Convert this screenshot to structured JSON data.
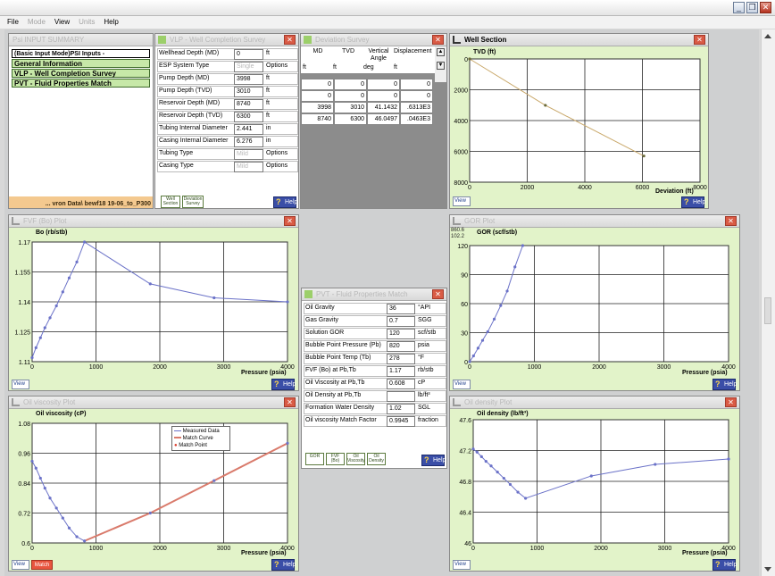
{
  "menu": [
    {
      "label": "File",
      "enabled": true
    },
    {
      "label": "Mode",
      "enabled": false
    },
    {
      "label": "View",
      "enabled": true
    },
    {
      "label": "Units",
      "enabled": false
    },
    {
      "label": "Help",
      "enabled": true
    }
  ],
  "window_buttons": {
    "minimize": "_",
    "restore": "❒",
    "close": "✕"
  },
  "psi_input": {
    "title": "Psi INPUT SUMMARY",
    "items": [
      "(Basic Input Mode)PSI Inputs -",
      "General Information",
      "VLP - Well Completion Survey",
      "PVT - Fluid Properties Match"
    ],
    "path": "... vron Data\\ bewf18 19-06_to_P300"
  },
  "vlp": {
    "title": "VLP - Well Completion Survey",
    "rows": [
      {
        "label": "Wellhead Depth (MD)",
        "value": "0",
        "unit": "ft",
        "dim": false
      },
      {
        "label": "ESP System Type",
        "value": "Single",
        "unit": "Options",
        "dim": true
      },
      {
        "label": "Pump Depth (MD)",
        "value": "3998",
        "unit": "ft",
        "dim": false
      },
      {
        "label": "Pump Depth (TVD)",
        "value": "3010",
        "unit": "ft",
        "dim": false
      },
      {
        "label": "Reservoir Depth (MD)",
        "value": "8740",
        "unit": "ft",
        "dim": false
      },
      {
        "label": "Reservoir Depth (TVD)",
        "value": "6300",
        "unit": "ft",
        "dim": false
      },
      {
        "label": "Tubing Internal Diameter",
        "value": "2.441",
        "unit": "in",
        "dim": false
      },
      {
        "label": "Casing Internal Diameter",
        "value": "6.276",
        "unit": "in",
        "dim": false
      },
      {
        "label": "Tubing Type",
        "value": "Mild",
        "unit": "Options",
        "dim": true
      },
      {
        "label": "Casing Type",
        "value": "Mild",
        "unit": "Options",
        "dim": true
      }
    ],
    "buttons": [
      "Well Section",
      "Deviation Survey"
    ],
    "help": "Help"
  },
  "deviation": {
    "title": "Deviation Survey",
    "headers": [
      "MD",
      "TVD",
      "Vertical Angle",
      "Displacement"
    ],
    "header_units": [
      "ft",
      "ft",
      "deg",
      "ft"
    ],
    "rows": [
      [
        "0",
        "0",
        "0",
        "0"
      ],
      [
        "0",
        "0",
        "0",
        "0"
      ],
      [
        "3998",
        "3010",
        "41.1432",
        ".6313E3"
      ],
      [
        "8740",
        "6300",
        "46.0497",
        ".0463E3"
      ]
    ]
  },
  "well_section": {
    "title": "Well Section",
    "ylabel": "TVD (ft)",
    "xlabel": "Deviation (ft)",
    "view": "View",
    "help": "Help",
    "chart_data": {
      "type": "line",
      "x": [
        0,
        2630,
        6050
      ],
      "y": [
        0,
        3010,
        6300
      ],
      "xlim": [
        0,
        8000
      ],
      "ylim": [
        0,
        8000
      ],
      "xticks": [
        "0",
        "2000",
        "4000",
        "6000",
        "8000"
      ],
      "yticks": [
        "0",
        "2000",
        "4000",
        "6000",
        "8000"
      ],
      "y_inverted": true,
      "line_color": "#c9a86a"
    }
  },
  "fvf": {
    "title": "FVF (Bo) Plot",
    "ylabel": "Bo (rb/stb)",
    "xlabel": "Pressure (psia)",
    "view": "View",
    "help": "Help",
    "chart_data": {
      "type": "line",
      "x": [
        0,
        60,
        130,
        200,
        280,
        380,
        480,
        580,
        700,
        820,
        1850,
        2850,
        4000
      ],
      "y": [
        1.112,
        1.117,
        1.122,
        1.127,
        1.132,
        1.138,
        1.145,
        1.152,
        1.16,
        1.17,
        1.149,
        1.142,
        1.14
      ],
      "xlim": [
        0,
        4000
      ],
      "ylim": [
        1.11,
        1.17
      ],
      "xticks": [
        "0",
        "1000",
        "2000",
        "3000",
        "4000"
      ],
      "yticks": [
        "1.11",
        "1.125",
        "1.14",
        "1.155",
        "1.17"
      ],
      "line_color": "#6b72c8"
    }
  },
  "gor": {
    "title": "GOR Plot",
    "ylabel": "GOR (scf/stb)",
    "xlabel": "Pressure (psia)",
    "corner_labels": [
      "860.6",
      "102.2"
    ],
    "view": "View",
    "help": "Help",
    "chart_data": {
      "type": "line",
      "x": [
        0,
        60,
        130,
        200,
        280,
        380,
        480,
        580,
        700,
        820
      ],
      "y": [
        0,
        6,
        14,
        22,
        31,
        44,
        58,
        73,
        98,
        120
      ],
      "xlim": [
        0,
        4000
      ],
      "ylim": [
        0,
        120
      ],
      "xticks": [
        "0",
        "1000",
        "2000",
        "3000",
        "4000"
      ],
      "yticks": [
        "0",
        "30",
        "60",
        "90",
        "120"
      ],
      "line_color": "#6b72c8"
    }
  },
  "visc": {
    "title": "Oil viscosity Plot",
    "ylabel": "Oil viscosity (cP)",
    "xlabel": "Pressure (psia)",
    "legend": [
      "Measured Data",
      "Match Curve",
      "Match Point"
    ],
    "match_button": "Match",
    "view": "View",
    "help": "Help",
    "chart_data": {
      "type": "line",
      "x": [
        0,
        60,
        130,
        200,
        280,
        380,
        480,
        580,
        700,
        820,
        1850,
        2850,
        4000
      ],
      "y": [
        0.928,
        0.9,
        0.86,
        0.82,
        0.78,
        0.74,
        0.7,
        0.66,
        0.625,
        0.608,
        0.72,
        0.85,
        1.0
      ],
      "match_x": [
        820,
        1850,
        2850,
        4000
      ],
      "match_y": [
        0.608,
        0.72,
        0.85,
        1.0
      ],
      "xlim": [
        0,
        4000
      ],
      "ylim": [
        0.6,
        1.08
      ],
      "xticks": [
        "0",
        "1000",
        "2000",
        "3000",
        "4000"
      ],
      "yticks": [
        "0.6",
        "0.72",
        "0.84",
        "0.96",
        "1.08"
      ],
      "line_color": "#6b72c8",
      "match_color": "#d97a6b"
    }
  },
  "pvt": {
    "title": "PVT - Fluid Properties Match",
    "rows": [
      {
        "label": "Oil Gravity",
        "value": "36",
        "unit": "°API"
      },
      {
        "label": "Gas Gravity",
        "value": "0.7",
        "unit": "SGG"
      },
      {
        "label": "Solution GOR",
        "value": "120",
        "unit": "scf/stb"
      },
      {
        "label": "Bubble Point Pressure (Pb)",
        "value": "820",
        "unit": "psia"
      },
      {
        "label": "Bubble Point Temp (Tb)",
        "value": "278",
        "unit": "°F"
      },
      {
        "label": "FVF (Bo) at Pb,Tb",
        "value": "1.17",
        "unit": "rb/stb"
      },
      {
        "label": "Oil Viscosity at Pb,Tb",
        "value": "0.608",
        "unit": "cP"
      },
      {
        "label": "Oil Density at Pb,Tb",
        "value": "",
        "unit": "lb/ft³"
      },
      {
        "label": "Formation Water Density",
        "value": "1.02",
        "unit": "SGL"
      },
      {
        "label": "Oil viscosity Match Factor",
        "value": "0.9945",
        "unit": "fraction"
      }
    ],
    "buttons": [
      "GOR",
      "FVF (Bo)",
      "Oil Viscosity",
      "Oil Density"
    ],
    "help": "Help"
  },
  "density": {
    "title": "Oil density Plot",
    "ylabel": "Oil density (lb/ft³)",
    "xlabel": "Pressure (psia)",
    "view": "View",
    "help": "Help",
    "chart_data": {
      "type": "line",
      "x": [
        0,
        60,
        130,
        200,
        280,
        380,
        480,
        580,
        700,
        820,
        1850,
        2850,
        4000
      ],
      "y": [
        47.22,
        47.18,
        47.12,
        47.06,
        47.0,
        46.92,
        46.84,
        46.76,
        46.66,
        46.58,
        46.87,
        47.02,
        47.09
      ],
      "xlim": [
        0,
        4000
      ],
      "ylim": [
        46.5,
        47.5
      ],
      "xticks": [
        "0",
        "1000",
        "2000",
        "3000",
        "4000"
      ],
      "yticks": [
        "46",
        "46.4",
        "46.8",
        "47.2",
        "47.6"
      ],
      "ytick_values": [
        46.0,
        46.4,
        46.8,
        47.2,
        47.6
      ],
      "line_color": "#6b72c8"
    }
  }
}
